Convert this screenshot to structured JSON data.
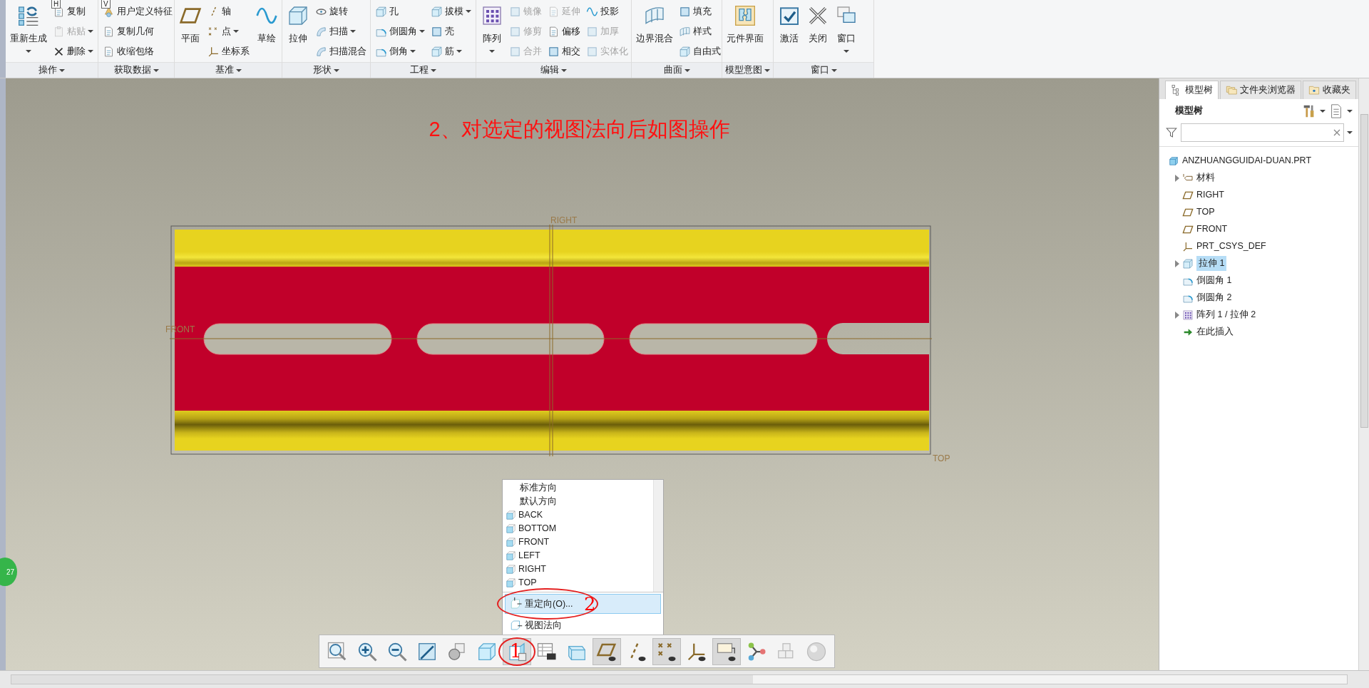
{
  "ribbon": {
    "groups": [
      {
        "label": "操作",
        "items": [
          {
            "label": "重新生成",
            "kind": "large",
            "dropdown": true,
            "disabled": false
          },
          {
            "label": "复制",
            "kind": "small",
            "dropdown": false,
            "disabled": false,
            "keytip": "H"
          },
          {
            "label": "粘贴",
            "kind": "small",
            "dropdown": true,
            "disabled": true
          },
          {
            "label": "删除",
            "kind": "small",
            "dropdown": true,
            "disabled": false
          }
        ]
      },
      {
        "label": "获取数据",
        "items": [
          {
            "label": "用户定义特征",
            "kind": "small",
            "dropdown": false,
            "disabled": false,
            "keytip": "V"
          },
          {
            "label": "复制几何",
            "kind": "small",
            "dropdown": false,
            "disabled": false
          },
          {
            "label": "收缩包络",
            "kind": "small",
            "dropdown": false,
            "disabled": false
          }
        ]
      },
      {
        "label": "基准",
        "items": [
          {
            "label": "平面",
            "kind": "large",
            "dropdown": false,
            "disabled": false
          },
          {
            "label": "轴",
            "kind": "small",
            "dropdown": false,
            "disabled": false
          },
          {
            "label": "点",
            "kind": "small",
            "dropdown": true,
            "disabled": false
          },
          {
            "label": "坐标系",
            "kind": "small",
            "dropdown": false,
            "disabled": false
          },
          {
            "label": "草绘",
            "kind": "large",
            "dropdown": false,
            "disabled": false
          }
        ]
      },
      {
        "label": "形状",
        "items": [
          {
            "label": "拉伸",
            "kind": "large",
            "dropdown": false,
            "disabled": false
          },
          {
            "label": "旋转",
            "kind": "small",
            "dropdown": false,
            "disabled": false
          },
          {
            "label": "扫描",
            "kind": "small",
            "dropdown": true,
            "disabled": false
          },
          {
            "label": "扫描混合",
            "kind": "small",
            "dropdown": false,
            "disabled": false
          }
        ]
      },
      {
        "label": "工程",
        "items": [
          {
            "label": "孔",
            "kind": "small",
            "dropdown": false,
            "disabled": false
          },
          {
            "label": "倒圆角",
            "kind": "small",
            "dropdown": true,
            "disabled": false
          },
          {
            "label": "倒角",
            "kind": "small",
            "dropdown": true,
            "disabled": false
          },
          {
            "label": "拔模",
            "kind": "small",
            "dropdown": true,
            "disabled": false
          },
          {
            "label": "壳",
            "kind": "small",
            "dropdown": false,
            "disabled": false
          },
          {
            "label": "筋",
            "kind": "small",
            "dropdown": true,
            "disabled": false
          }
        ]
      },
      {
        "label": "编辑",
        "items": [
          {
            "label": "阵列",
            "kind": "large",
            "dropdown": true,
            "disabled": false
          },
          {
            "label": "镜像",
            "kind": "small",
            "dropdown": false,
            "disabled": true
          },
          {
            "label": "修剪",
            "kind": "small",
            "dropdown": false,
            "disabled": true
          },
          {
            "label": "合并",
            "kind": "small",
            "dropdown": false,
            "disabled": true
          },
          {
            "label": "延伸",
            "kind": "small",
            "dropdown": false,
            "disabled": true
          },
          {
            "label": "偏移",
            "kind": "small",
            "dropdown": false,
            "disabled": false
          },
          {
            "label": "相交",
            "kind": "small",
            "dropdown": false,
            "disabled": false
          },
          {
            "label": "投影",
            "kind": "small",
            "dropdown": false,
            "disabled": false
          },
          {
            "label": "加厚",
            "kind": "small",
            "dropdown": false,
            "disabled": true
          },
          {
            "label": "实体化",
            "kind": "small",
            "dropdown": false,
            "disabled": true
          }
        ]
      },
      {
        "label": "曲面",
        "items": [
          {
            "label": "边界混合",
            "kind": "large",
            "dropdown": false,
            "disabled": false
          },
          {
            "label": "填充",
            "kind": "small",
            "dropdown": false,
            "disabled": false
          },
          {
            "label": "样式",
            "kind": "small",
            "dropdown": false,
            "disabled": false
          },
          {
            "label": "自由式",
            "kind": "small",
            "dropdown": false,
            "disabled": false
          }
        ]
      },
      {
        "label": "模型意图",
        "items": [
          {
            "label": "元件界面",
            "kind": "large",
            "dropdown": false,
            "disabled": false
          }
        ]
      },
      {
        "label": "窗口",
        "items": [
          {
            "label": "激活",
            "kind": "large",
            "dropdown": false,
            "disabled": false
          },
          {
            "label": "关闭",
            "kind": "large",
            "dropdown": false,
            "disabled": false
          },
          {
            "label": "窗口",
            "kind": "large",
            "dropdown": true,
            "disabled": false
          }
        ]
      }
    ]
  },
  "canvas": {
    "note": "2、对选定的视图法向后如图操作",
    "datum_labels": [
      "RIGHT",
      "FRONT",
      "TOP"
    ],
    "side_badge": "27"
  },
  "view_menu": {
    "items": [
      {
        "label": "标准方向",
        "kind": "text"
      },
      {
        "label": "默认方向",
        "kind": "text"
      },
      {
        "label": "BACK",
        "kind": "view"
      },
      {
        "label": "BOTTOM",
        "kind": "view"
      },
      {
        "label": "FRONT",
        "kind": "view"
      },
      {
        "label": "LEFT",
        "kind": "view"
      },
      {
        "label": "RIGHT",
        "kind": "view"
      },
      {
        "label": "TOP",
        "kind": "view"
      }
    ],
    "actions": [
      {
        "label": "重定向(O)...",
        "selected": true,
        "annotation": "2"
      },
      {
        "label": "视图法向",
        "selected": false
      }
    ]
  },
  "view_toolbar": {
    "buttons": [
      {
        "pressed": false
      },
      {
        "pressed": false
      },
      {
        "pressed": false
      },
      {
        "pressed": false
      },
      {
        "pressed": false
      },
      {
        "pressed": false
      },
      {
        "pressed": true,
        "annotation": "1"
      },
      {
        "pressed": false
      },
      {
        "pressed": false
      },
      {
        "pressed": true
      },
      {
        "pressed": false
      },
      {
        "pressed": true
      },
      {
        "pressed": false
      },
      {
        "pressed": true
      },
      {
        "pressed": false
      },
      {
        "pressed": false
      },
      {
        "pressed": false
      }
    ]
  },
  "model_tree": {
    "tabs": [
      {
        "label": "模型树",
        "selected": true
      },
      {
        "label": "文件夹浏览器",
        "selected": false
      },
      {
        "label": "收藏夹",
        "selected": false
      }
    ],
    "header": "模型树",
    "items": [
      {
        "label": "ANZHUANGGUIDAI-DUAN.PRT",
        "kind": "part",
        "children": [
          {
            "label": "材料",
            "kind": "material",
            "expandable": true,
            "selected": false
          },
          {
            "label": "RIGHT",
            "kind": "plane",
            "expandable": false,
            "selected": false
          },
          {
            "label": "TOP",
            "kind": "plane",
            "expandable": false,
            "selected": false
          },
          {
            "label": "FRONT",
            "kind": "plane",
            "expandable": false,
            "selected": false
          },
          {
            "label": "PRT_CSYS_DEF",
            "kind": "csys",
            "expandable": false,
            "selected": false
          },
          {
            "label": "拉伸 1",
            "kind": "extrude",
            "expandable": true,
            "selected": true
          },
          {
            "label": "倒圆角 1",
            "kind": "round",
            "expandable": false,
            "selected": false
          },
          {
            "label": "倒圆角 2",
            "kind": "round",
            "expandable": false,
            "selected": false
          },
          {
            "label": "阵列 1 / 拉伸 2",
            "kind": "pattern",
            "expandable": true,
            "selected": false
          },
          {
            "label": "在此插入",
            "kind": "insert",
            "expandable": false,
            "selected": false
          }
        ]
      }
    ]
  }
}
